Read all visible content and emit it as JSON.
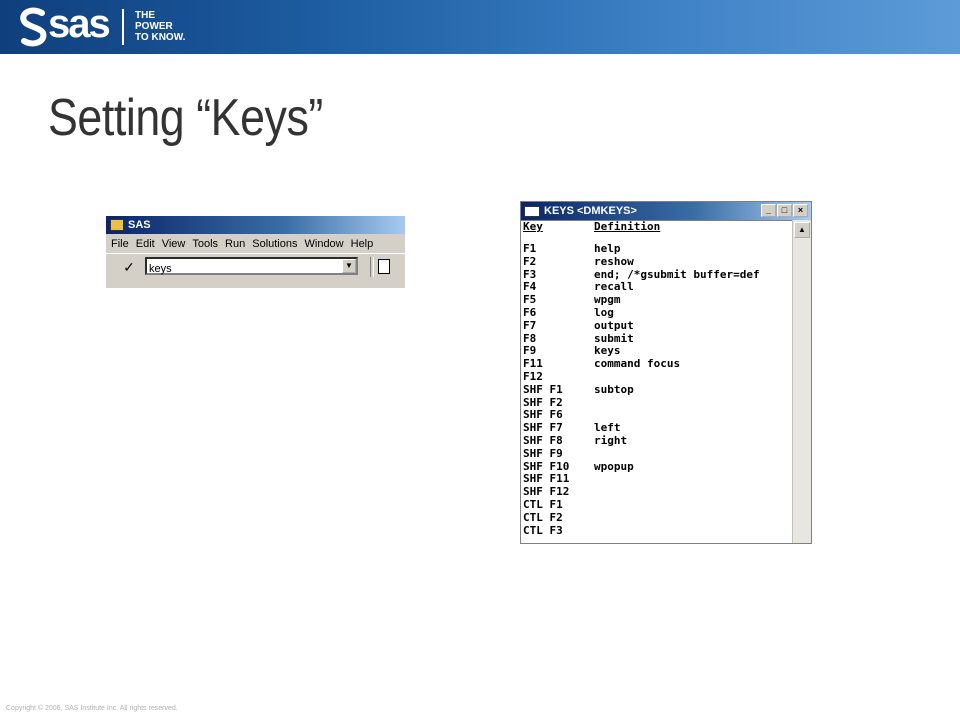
{
  "banner": {
    "logo_text": "sas",
    "tagline": [
      "THE",
      "POWER",
      "TO KNOW."
    ]
  },
  "slide": {
    "title": "Setting “Keys”"
  },
  "sas_window": {
    "title": "SAS",
    "menu": [
      "File",
      "Edit",
      "View",
      "Tools",
      "Run",
      "Solutions",
      "Window",
      "Help"
    ],
    "command_value": "keys"
  },
  "keys_window": {
    "title": "KEYS <DMKEYS>",
    "header": {
      "key": "Key",
      "definition": "Definition"
    },
    "rows": [
      {
        "key": "F1",
        "def": "help"
      },
      {
        "key": "F2",
        "def": "reshow"
      },
      {
        "key": "F3",
        "def": "end; /*gsubmit buffer=def"
      },
      {
        "key": "F4",
        "def": "recall"
      },
      {
        "key": "F5",
        "def": "wpgm"
      },
      {
        "key": "F6",
        "def": "log"
      },
      {
        "key": "F7",
        "def": "output"
      },
      {
        "key": "F8",
        "def": "submit"
      },
      {
        "key": "F9",
        "def": "keys"
      },
      {
        "key": "F11",
        "def": "command focus"
      },
      {
        "key": "F12",
        "def": ""
      },
      {
        "key": "SHF F1",
        "def": "subtop"
      },
      {
        "key": "SHF F2",
        "def": ""
      },
      {
        "key": "SHF F6",
        "def": ""
      },
      {
        "key": "SHF F7",
        "def": "left"
      },
      {
        "key": "SHF F8",
        "def": "right"
      },
      {
        "key": "SHF F9",
        "def": ""
      },
      {
        "key": "SHF F10",
        "def": "wpopup"
      },
      {
        "key": "SHF F11",
        "def": ""
      },
      {
        "key": "SHF F12",
        "def": ""
      },
      {
        "key": "CTL F1",
        "def": ""
      },
      {
        "key": "CTL F2",
        "def": ""
      },
      {
        "key": "CTL F3",
        "def": ""
      }
    ]
  },
  "footer": {
    "copyright": "Copyright © 2006, SAS Institute Inc. All rights reserved."
  }
}
